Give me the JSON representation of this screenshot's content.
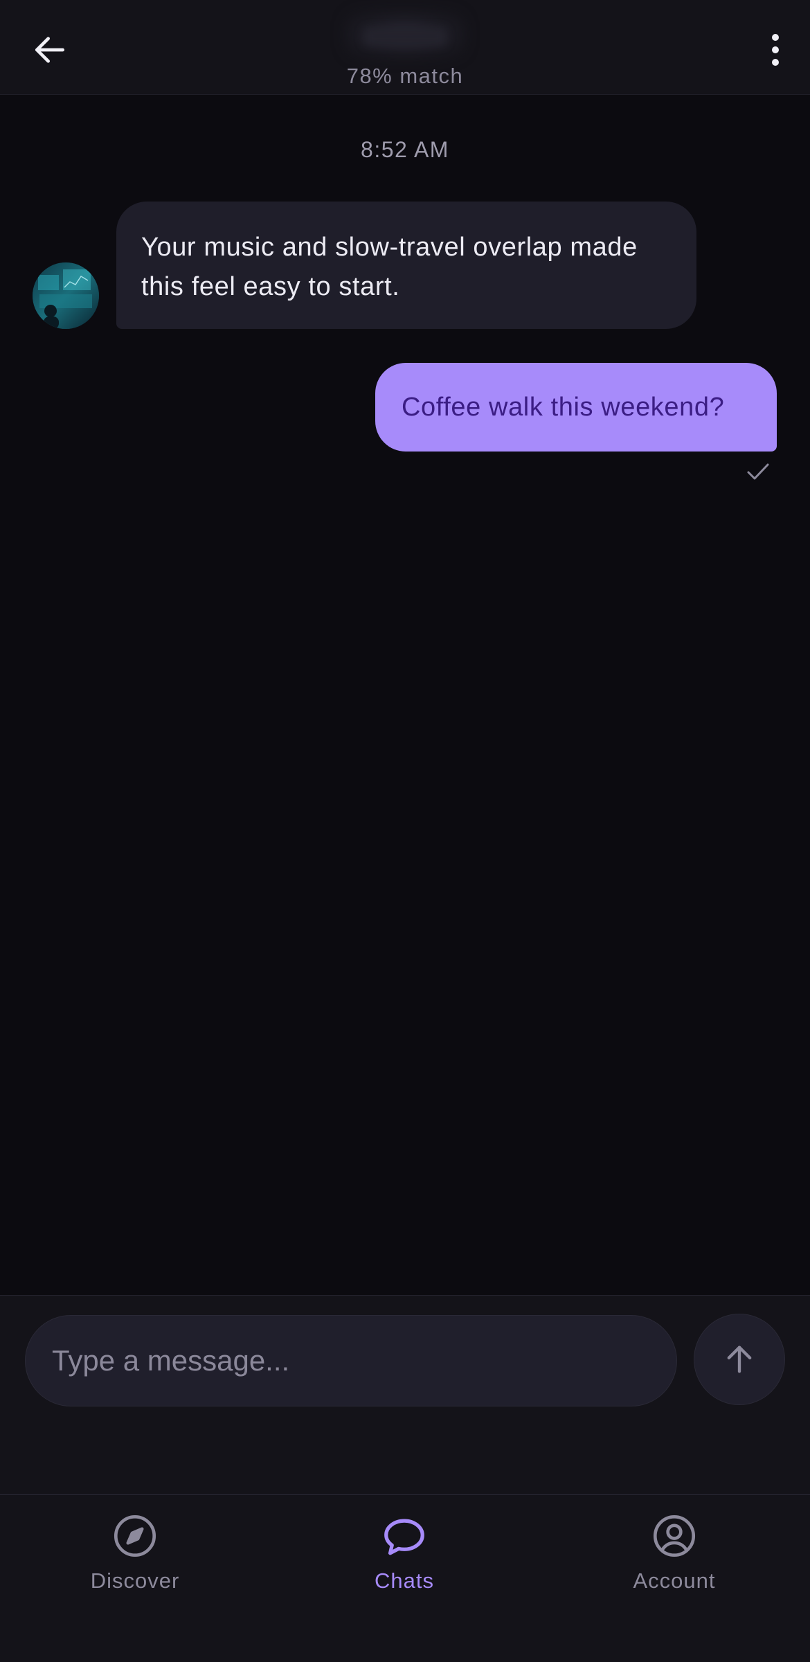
{
  "header": {
    "match_text": "78% match",
    "back_icon": "arrow-left-icon",
    "menu_icon": "more-vertical-icon"
  },
  "conversation": {
    "timestamp": "8:52 AM",
    "messages": [
      {
        "direction": "incoming",
        "text": "Your music and slow-travel overlap made this feel easy to start."
      },
      {
        "direction": "outgoing",
        "text": "Coffee walk this weekend?",
        "status_icon": "check-icon"
      }
    ]
  },
  "composer": {
    "placeholder": "Type a message...",
    "send_icon": "arrow-up-icon"
  },
  "nav": {
    "items": [
      {
        "label": "Discover",
        "icon": "compass-icon",
        "active": false
      },
      {
        "label": "Chats",
        "icon": "chat-bubble-icon",
        "active": true
      },
      {
        "label": "Account",
        "icon": "user-circle-icon",
        "active": false
      }
    ]
  },
  "colors": {
    "background": "#0c0b10",
    "surface": "#141319",
    "bubble_incoming": "#1f1e2a",
    "accent": "#a78bfa",
    "outgoing_text": "#3b1d84",
    "muted_text": "#8d8a9c"
  }
}
